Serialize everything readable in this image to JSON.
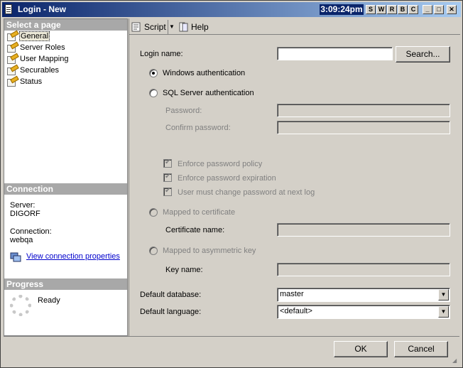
{
  "window": {
    "title": "Login - New"
  },
  "titlebar": {
    "clock": "3:09:24pm",
    "tool_buttons": [
      "S",
      "W",
      "R",
      "B",
      "C"
    ],
    "min": "_",
    "max": "□",
    "close": "✕"
  },
  "left": {
    "select_page_header": "Select a page",
    "pages": [
      "General",
      "Server Roles",
      "User Mapping",
      "Securables",
      "Status"
    ],
    "connection_header": "Connection",
    "server_label": "Server:",
    "server_value": "DIGORF",
    "connection_label": "Connection:",
    "connection_value": "webqa",
    "view_props_link": "View connection properties",
    "progress_header": "Progress",
    "progress_status": "Ready"
  },
  "toolbar": {
    "script": "Script",
    "help": "Help"
  },
  "form": {
    "login_name_label": "Login name:",
    "login_name_value": "",
    "search_button": "Search...",
    "windows_auth": "Windows authentication",
    "sql_auth": "SQL Server authentication",
    "password_label": "Password:",
    "confirm_password_label": "Confirm password:",
    "enforce_policy": "Enforce password policy",
    "enforce_expiration": "Enforce password expiration",
    "must_change": "User must change password at next login",
    "mapped_cert": "Mapped to certificate",
    "cert_name_label": "Certificate name:",
    "mapped_key": "Mapped to asymmetric key",
    "key_name_label": "Key name:",
    "default_db_label": "Default database:",
    "default_db_value": "master",
    "default_lang_label": "Default language:",
    "default_lang_value": "<default>"
  },
  "footer": {
    "ok": "OK",
    "cancel": "Cancel"
  }
}
